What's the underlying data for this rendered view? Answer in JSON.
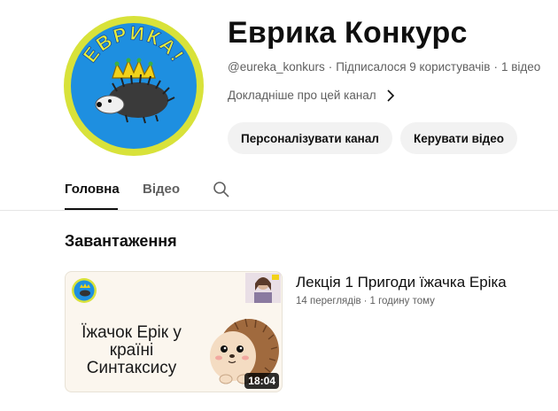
{
  "channel": {
    "avatar_text": "ЕВРИКА!",
    "title": "Еврика Конкурс",
    "handle": "@eureka_konkurs",
    "subscribers": "Підписалося 9 користувачів",
    "video_count": "1 відео",
    "separator": "·",
    "more_link": "Докладніше про цей канал"
  },
  "buttons": {
    "customize": "Персоналізувати канал",
    "manage": "Керувати відео"
  },
  "tabs": [
    {
      "label": "Головна",
      "active": true
    },
    {
      "label": "Відео",
      "active": false
    }
  ],
  "section": {
    "title": "Завантаження"
  },
  "videos": [
    {
      "title": "Лекція 1 Пригоди їжачка Еріка",
      "views": "14 переглядів",
      "age": "1 годину тому",
      "separator": "·",
      "duration": "18:04",
      "thumbnail_text": [
        "Їжачок Ерік у",
        "країні",
        "Синтаксису"
      ]
    }
  ],
  "colors": {
    "avatar_ring": "#d8e23a",
    "avatar_bg": "#1e8fe0",
    "text_secondary": "#606060",
    "button_bg": "#f2f2f2"
  }
}
